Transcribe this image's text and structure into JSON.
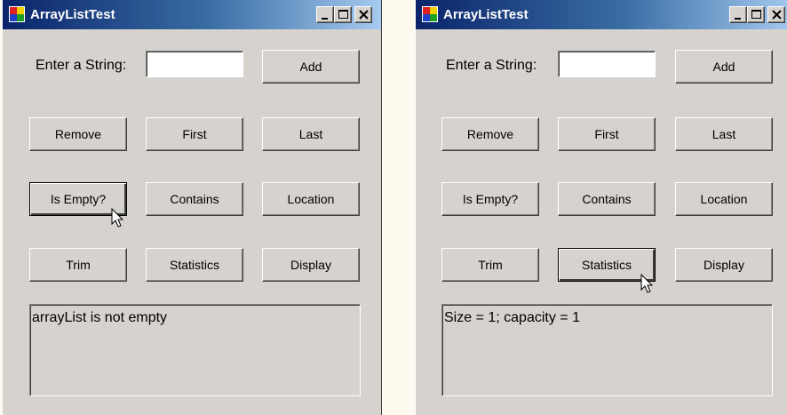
{
  "windows": [
    {
      "title": "ArrayListTest",
      "prompt_label": "Enter a String:",
      "input_value": "",
      "buttons": {
        "add": "Add",
        "remove": "Remove",
        "first": "First",
        "last": "Last",
        "is_empty": "Is Empty?",
        "contains": "Contains",
        "location": "Location",
        "trim": "Trim",
        "statistics": "Statistics",
        "display": "Display"
      },
      "focused_button": "is_empty",
      "output_text": "arrayList is not empty"
    },
    {
      "title": "ArrayListTest",
      "prompt_label": "Enter a String:",
      "input_value": "",
      "buttons": {
        "add": "Add",
        "remove": "Remove",
        "first": "First",
        "last": "Last",
        "is_empty": "Is Empty?",
        "contains": "Contains",
        "location": "Location",
        "trim": "Trim",
        "statistics": "Statistics",
        "display": "Display"
      },
      "focused_button": "statistics",
      "output_text": "Size = 1; capacity = 1"
    }
  ],
  "colors": {
    "titlebar_start": "#0a246a",
    "titlebar_end": "#a6caf0",
    "window_face": "#d6d3ce",
    "page_background": "#fdf9ee"
  }
}
